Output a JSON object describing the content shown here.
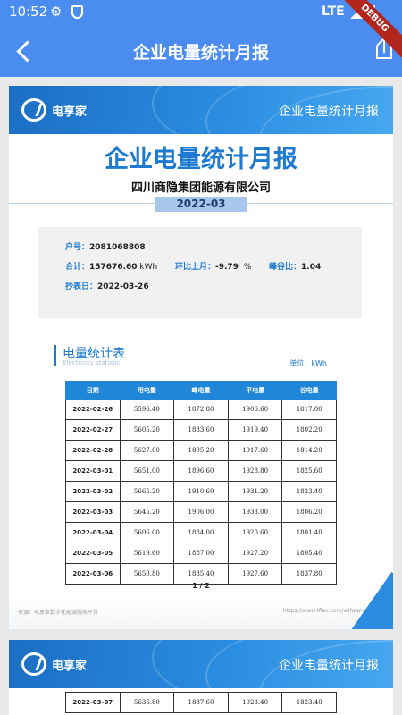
{
  "status_bar": {
    "time": "10:52",
    "network": "LTE",
    "debug_label": "DEBUG"
  },
  "app_bar": {
    "title": "企业电量统计月报"
  },
  "report": {
    "brand": "电享家",
    "banner_title": "企业电量统计月报",
    "title": "企业电量统计月报",
    "company": "四川商隐集团能源有限公司",
    "month": "2022-03",
    "info": {
      "account_label": "户号：",
      "account": "2081068808",
      "total_label": "合计：",
      "total_value": "157676.60",
      "total_unit": "kWh",
      "mom_label": "环比上月：",
      "mom_value": "-9.79",
      "mom_unit": "%",
      "ratio_label": "峰谷比：",
      "ratio_value": "1.04",
      "read_date_label": "抄表日：",
      "read_date": "2022-03-26"
    },
    "section": {
      "title": "电量统计表",
      "subtitle": "Electricity statistic",
      "unit": "单位：kWh"
    },
    "table": {
      "headers": [
        "日期",
        "用电量",
        "峰电量",
        "平电量",
        "谷电量"
      ],
      "rows": [
        [
          "2022-02-26",
          "5596.40",
          "1872.80",
          "1906.60",
          "1817.00"
        ],
        [
          "2022-02-27",
          "5605.20",
          "1883.60",
          "1919.40",
          "1802.20"
        ],
        [
          "2022-02-28",
          "5627.00",
          "1895.20",
          "1917.60",
          "1814.20"
        ],
        [
          "2022-03-01",
          "5651.00",
          "1896.60",
          "1928.80",
          "1825.60"
        ],
        [
          "2022-03-02",
          "5665.20",
          "1910.60",
          "1931.20",
          "1823.40"
        ],
        [
          "2022-03-03",
          "5645.20",
          "1906.00",
          "1933.00",
          "1806.20"
        ],
        [
          "2022-03-04",
          "5606.00",
          "1884.00",
          "1920.60",
          "1801.40"
        ],
        [
          "2022-03-05",
          "5619.60",
          "1887.00",
          "1927.20",
          "1805.40"
        ],
        [
          "2022-03-06",
          "5650.80",
          "1885.40",
          "1927.60",
          "1837.80"
        ]
      ]
    },
    "page_number": "1 / 2",
    "footer_source": "来源：电享家数字化能源服务平台",
    "footer_url": "https://www.tflac.com/wthew-o/"
  },
  "page2": {
    "brand": "电享家",
    "banner_title": "企业电量统计月报",
    "rows": [
      [
        "2022-03-07",
        "5636.80",
        "1887.60",
        "1923.40",
        "1823.40"
      ]
    ]
  }
}
